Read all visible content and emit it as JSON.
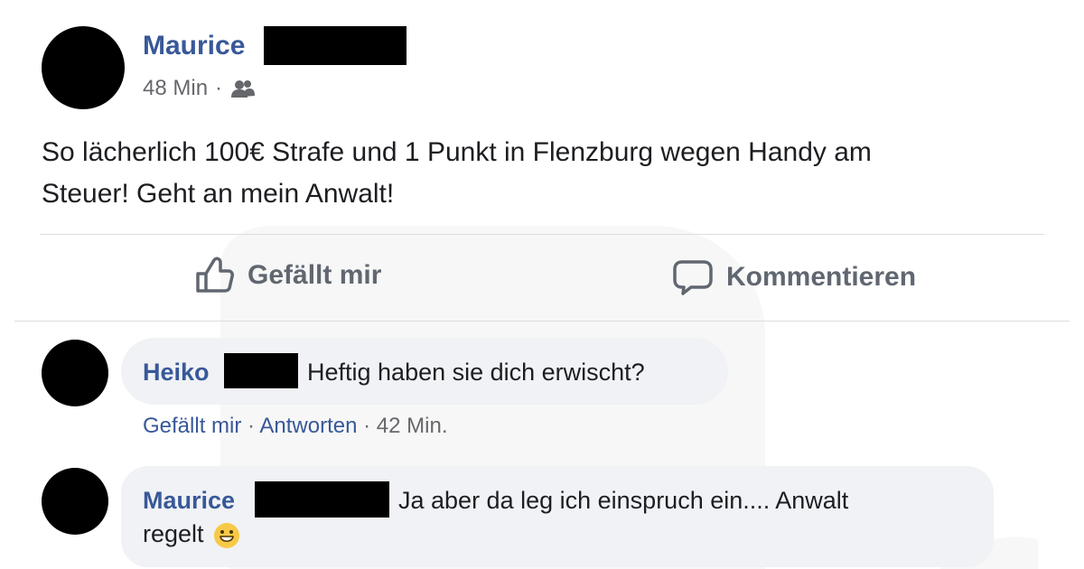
{
  "post": {
    "author_name": "Maurice",
    "time": "48 Min",
    "separator": "·",
    "audience_icon": "friends-icon",
    "text": "So lächerlich 100€ Strafe und 1 Punkt in Flenzburg wegen Handy am\nSteuer! Geht an mein Anwalt!"
  },
  "actions": {
    "like_label": "Gefällt mir",
    "comment_label": "Kommentieren",
    "like_icon": "thumbs-up-icon",
    "comment_icon": "comment-icon"
  },
  "comments": [
    {
      "author_name": "Heiko",
      "text": "Heftig haben sie dich erwischt?",
      "meta": {
        "like_label": "Gefällt mir",
        "separator_1": "·",
        "reply_label": "Antworten",
        "separator_2": "·",
        "time": "42 Min."
      }
    },
    {
      "author_name": "Maurice",
      "text_line1": "Ja aber da leg ich einspruch ein.... Anwalt",
      "text_line2": "regelt",
      "emoji_icon": "grinning-emoji-icon"
    }
  ],
  "colors": {
    "name_blue": "#385898",
    "text_dark": "#1c1e21",
    "meta_gray": "#65676b",
    "action_gray": "#606770",
    "bubble_gray": "#f0f2f5",
    "divider": "#dcdde1",
    "redaction": "#000000"
  }
}
